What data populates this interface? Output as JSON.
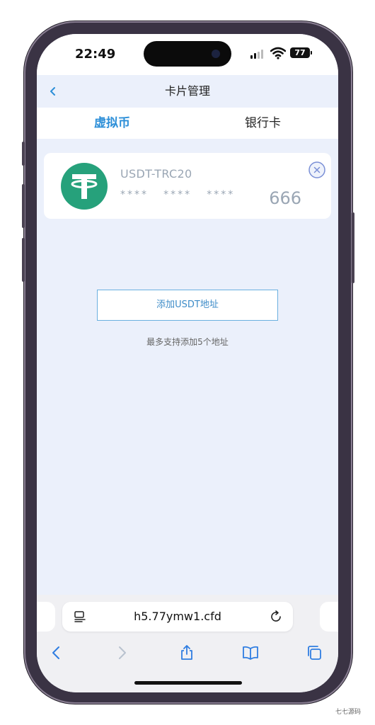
{
  "status": {
    "time": "22:49",
    "battery": "77"
  },
  "header": {
    "title": "卡片管理"
  },
  "tabs": [
    {
      "label": "虚拟币",
      "active": true
    },
    {
      "label": "银行卡",
      "active": false
    }
  ],
  "card": {
    "coin_name": "USDT-TRC20",
    "mask_groups": [
      "****",
      "****",
      "****"
    ],
    "last_digits": "666",
    "logo_icon": "tether-icon"
  },
  "actions": {
    "add_label": "添加USDT地址",
    "limit_note": "最多支持添加5个地址"
  },
  "browser": {
    "url": "h5.77ymw1.cfd"
  },
  "watermark": "七七源码",
  "colors": {
    "accent": "#2d8fd8",
    "tether": "#26a17b",
    "page_bg": "#ebf0fb",
    "muted_text": "#9aa6b4"
  }
}
